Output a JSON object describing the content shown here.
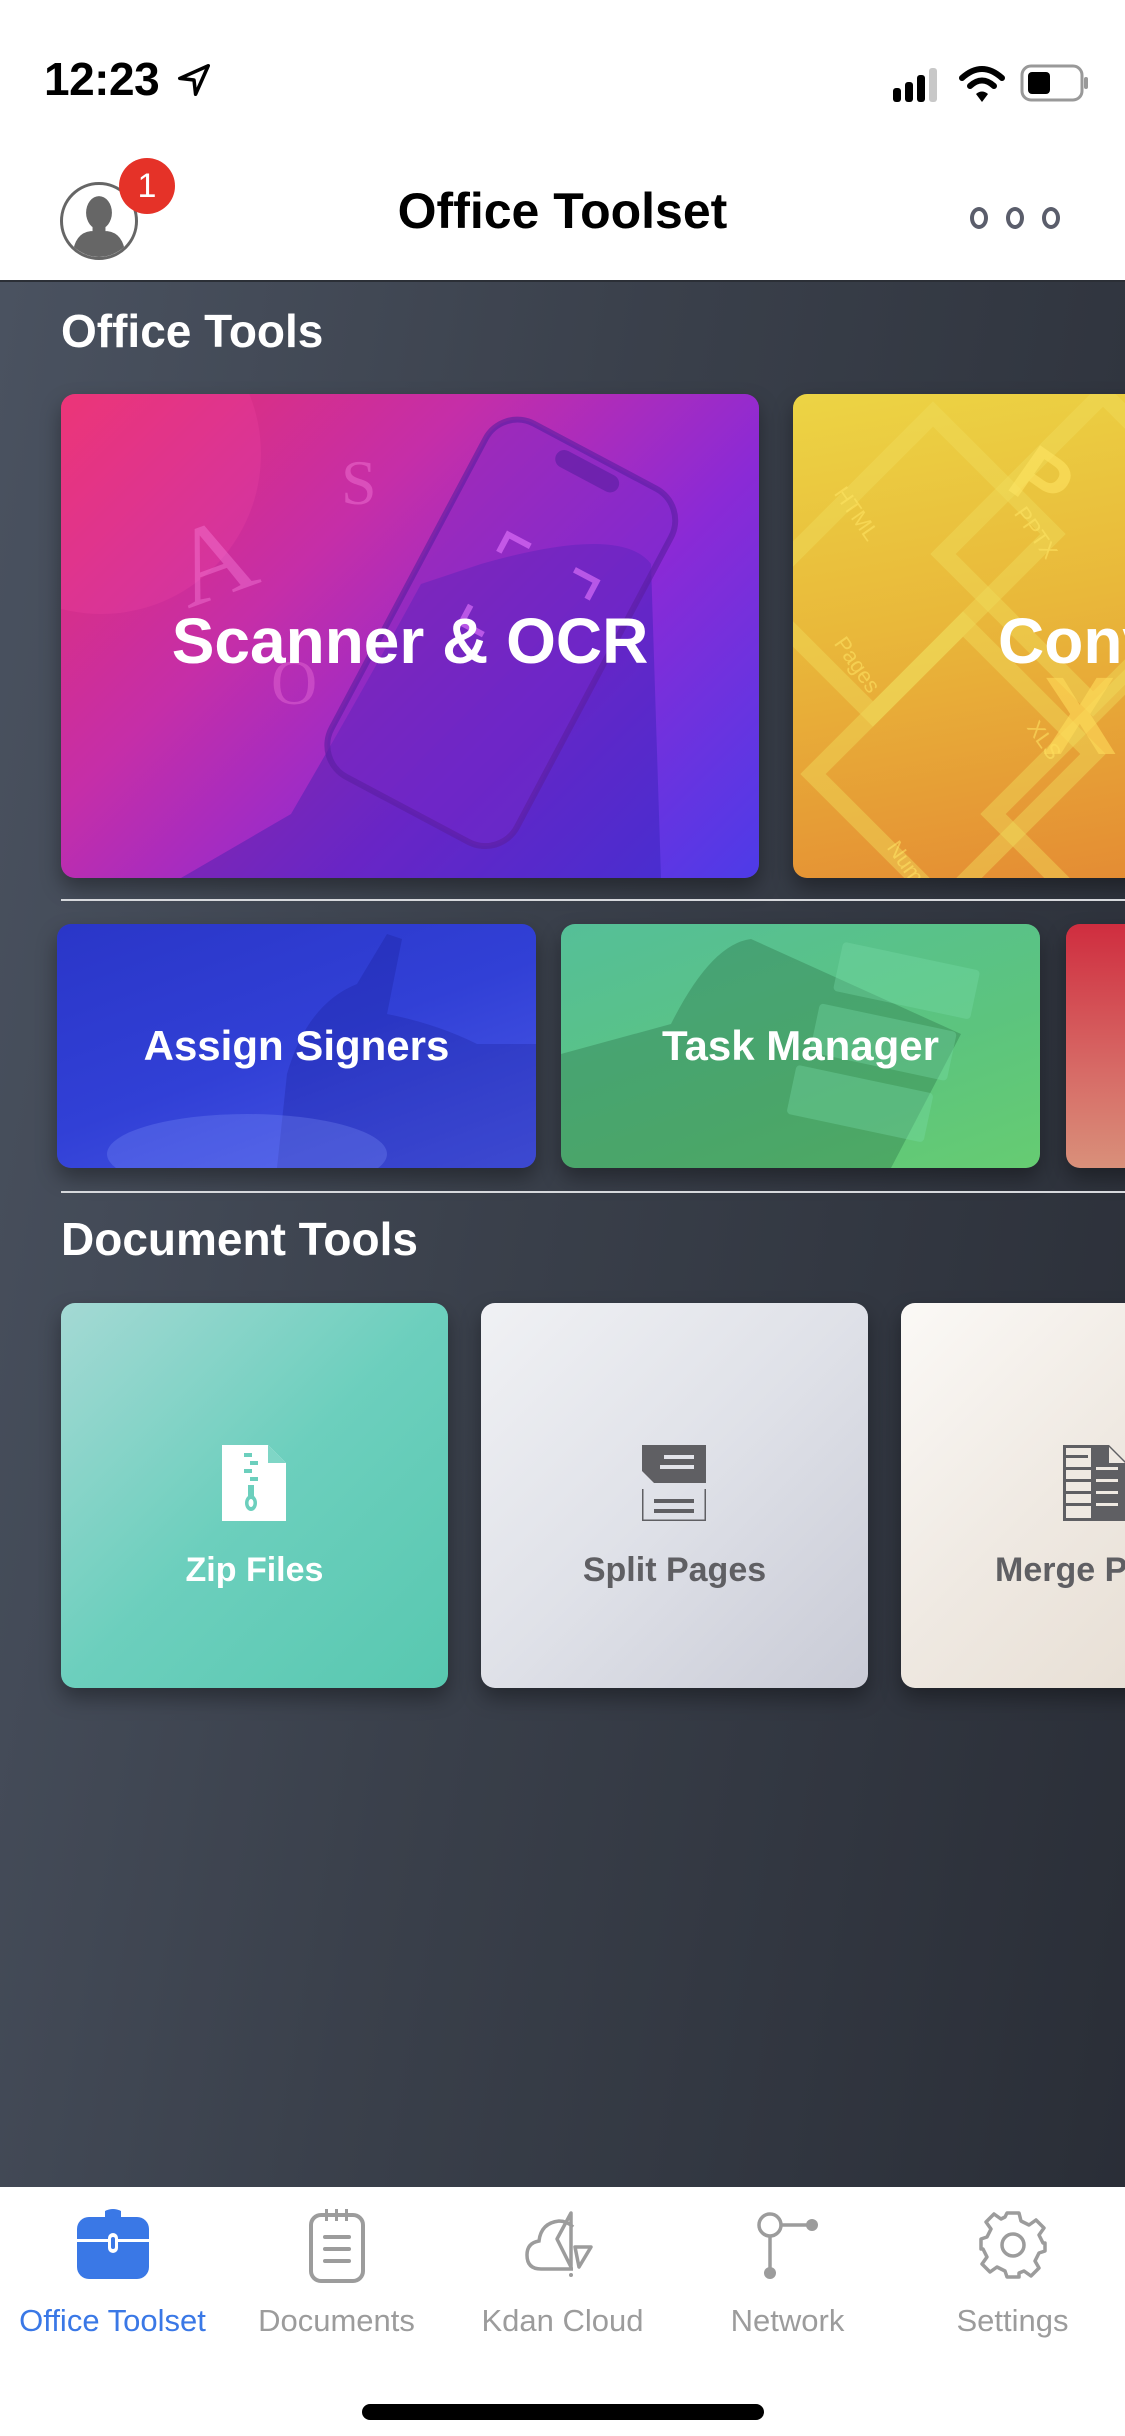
{
  "status_bar": {
    "time": "12:23",
    "icons": [
      "location-arrow-icon",
      "cellular-signal-icon",
      "wifi-icon",
      "battery-icon"
    ]
  },
  "nav": {
    "title": "Office Toolset",
    "notification_count": "1",
    "avatar_icon": "user-avatar-icon",
    "more_icon": "more-dots-icon"
  },
  "sections": {
    "office_tools": {
      "title": "Office Tools",
      "featured": [
        {
          "label": "Scanner & OCR",
          "color": "#c52ea8"
        },
        {
          "label": "Conv",
          "color": "#e9b83a",
          "decor_text": [
            "HTML",
            "PPTX",
            "Pages",
            "XLS",
            "Num"
          ]
        }
      ],
      "tools": [
        {
          "label": "Assign Signers",
          "color": "#3140d6"
        },
        {
          "label": "Task Manager",
          "color": "#5cc47e"
        },
        {
          "label": "",
          "color": "#cf2d3f"
        }
      ]
    },
    "document_tools": {
      "title": "Document Tools",
      "tools": [
        {
          "label": "Zip Files",
          "icon": "zip-file-icon",
          "color": "#6ccfbd"
        },
        {
          "label": "Split Pages",
          "icon": "split-pages-icon",
          "color": "#dfe1e8"
        },
        {
          "label": "Merge P",
          "icon": "merge-pages-icon",
          "color": "#efe9e2"
        }
      ]
    }
  },
  "tab_bar": {
    "active_color": "#3a78e6",
    "inactive_color": "#9c9c9c",
    "tabs": [
      {
        "label": "Office Toolset",
        "icon": "toolbox-icon",
        "active": true
      },
      {
        "label": "Documents",
        "icon": "notepad-icon",
        "active": false
      },
      {
        "label": "Kdan Cloud",
        "icon": "cloud-icon",
        "active": false
      },
      {
        "label": "Network",
        "icon": "network-icon",
        "active": false
      },
      {
        "label": "Settings",
        "icon": "gear-icon",
        "active": false
      }
    ]
  }
}
